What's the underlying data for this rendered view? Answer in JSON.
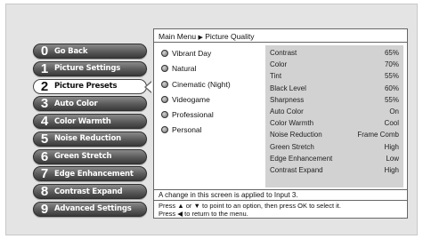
{
  "menu": {
    "items": [
      {
        "number": "0",
        "label": "Go Back"
      },
      {
        "number": "1",
        "label": "Picture Settings"
      },
      {
        "number": "2",
        "label": "Picture Presets"
      },
      {
        "number": "3",
        "label": "Auto Color"
      },
      {
        "number": "4",
        "label": "Color Warmth"
      },
      {
        "number": "5",
        "label": "Noise Reduction"
      },
      {
        "number": "6",
        "label": "Green Stretch"
      },
      {
        "number": "7",
        "label": "Edge Enhancement"
      },
      {
        "number": "8",
        "label": "Contrast Expand"
      },
      {
        "number": "9",
        "label": "Advanced Settings"
      }
    ],
    "selected_index": 2
  },
  "breadcrumb": {
    "root": "Main Menu",
    "separator": "▶",
    "current": "Picture Quality"
  },
  "presets": [
    "Vibrant Day",
    "Natural",
    "Cinematic (Night)",
    "Videogame",
    "Professional",
    "Personal"
  ],
  "settings": [
    {
      "name": "Contrast",
      "value": "65%"
    },
    {
      "name": "Color",
      "value": "70%"
    },
    {
      "name": "Tint",
      "value": "55%"
    },
    {
      "name": "Black Level",
      "value": "60%"
    },
    {
      "name": "Sharpness",
      "value": "55%"
    },
    {
      "name": "Auto Color",
      "value": "On"
    },
    {
      "name": "Color Warmth",
      "value": "Cool"
    },
    {
      "name": "Noise Reduction",
      "value": "Frame Comb"
    },
    {
      "name": "Green Stretch",
      "value": "High"
    },
    {
      "name": "Edge Enhancement",
      "value": "Low"
    },
    {
      "name": "Contrast Expand",
      "value": "High"
    }
  ],
  "notice": "A change in this screen is applied to Input 3.",
  "help": {
    "line1": "Press ▲ or ▼ to point to an option, then press OK to select it.",
    "line2": "Press ◀ to return to the menu."
  },
  "colors": {
    "background": "#e4e4e4",
    "button_dark": "#4a4a4a",
    "settings_box": "#d2d2d2"
  }
}
